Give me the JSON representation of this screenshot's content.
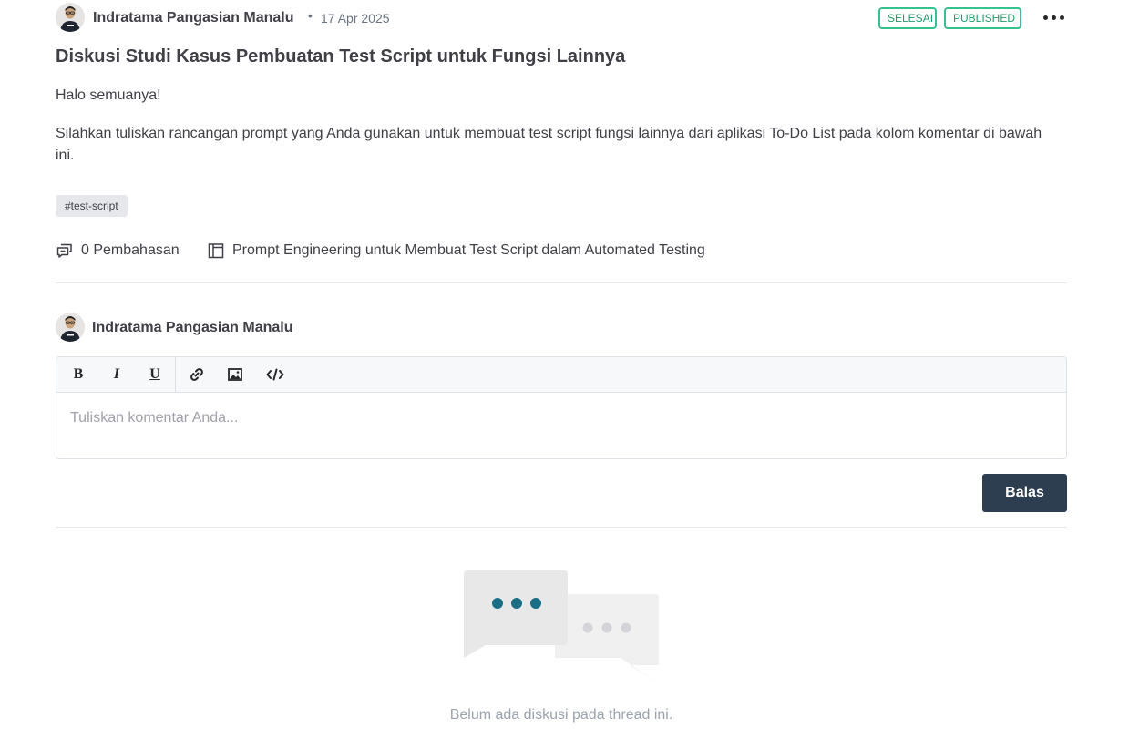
{
  "post": {
    "author": "Indratama Pangasian Manalu",
    "separator": "•",
    "date": "17 Apr 2025",
    "badges": {
      "status": "SELESAI",
      "publish": "PUBLISHED"
    },
    "title": "Diskusi Studi Kasus Pembuatan Test Script untuk Fungsi Lainnya",
    "body": [
      "Halo semuanya!",
      "Silahkan tuliskan rancangan prompt yang Anda gunakan untuk membuat test script fungsi lainnya dari aplikasi To-Do List pada kolom komentar di bawah ini."
    ],
    "tag": "#test-script",
    "meta": {
      "discussion_count": "0 Pembahasan",
      "course": "Prompt Engineering untuk Membuat Test Script dalam Automated Testing"
    }
  },
  "comment_form": {
    "user": "Indratama Pangasian Manalu",
    "toolbar": {
      "bold": "B",
      "italic": "I",
      "underline": "U"
    },
    "placeholder": "Tuliskan komentar Anda...",
    "value": "",
    "submit_label": "Balas"
  },
  "empty_state": {
    "message": "Belum ada diskusi pada thread ini."
  },
  "colors": {
    "badge_border": "#34c38f",
    "button_bg": "#2d3e50",
    "chat_dots_primary": "#1a6f86",
    "chat_dots_secondary": "#d4d4d8"
  },
  "icons": [
    "more-options-icon",
    "discussion-icon",
    "course-icon",
    "link-icon",
    "image-icon",
    "code-icon"
  ]
}
